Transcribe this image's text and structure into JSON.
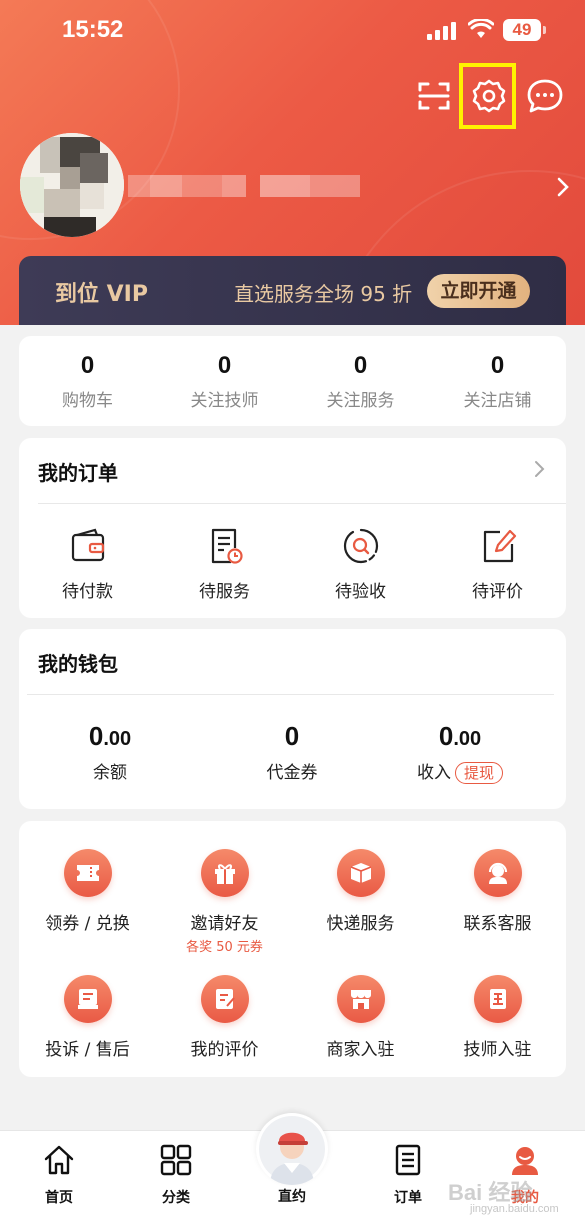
{
  "status_bar": {
    "time": "15:52",
    "battery": "49"
  },
  "header": {
    "icons": [
      "scan-icon",
      "settings-icon",
      "message-icon"
    ]
  },
  "vip": {
    "title": "到位 VIP",
    "desc": "直选服务全场 95 折",
    "button": "立即开通"
  },
  "stats": [
    {
      "value": "0",
      "label": "购物车"
    },
    {
      "value": "0",
      "label": "关注技师"
    },
    {
      "value": "0",
      "label": "关注服务"
    },
    {
      "value": "0",
      "label": "关注店铺"
    }
  ],
  "orders": {
    "title": "我的订单",
    "items": [
      {
        "label": "待付款",
        "icon": "wallet-icon"
      },
      {
        "label": "待服务",
        "icon": "service-doc-icon"
      },
      {
        "label": "待验收",
        "icon": "inspect-icon"
      },
      {
        "label": "待评价",
        "icon": "review-edit-icon"
      }
    ]
  },
  "wallet": {
    "title": "我的钱包",
    "items": [
      {
        "int": "0",
        "dec": ".00",
        "label": "余额"
      },
      {
        "int": "0",
        "dec": "",
        "label": "代金券"
      },
      {
        "int": "0",
        "dec": ".00",
        "label": "收入",
        "action": "提现"
      }
    ]
  },
  "services": [
    {
      "label": "领券 / 兑换",
      "icon": "coupon-icon"
    },
    {
      "label": "邀请好友",
      "sub": "各奖 50 元券",
      "icon": "gift-icon"
    },
    {
      "label": "快递服务",
      "icon": "package-icon"
    },
    {
      "label": "联系客服",
      "icon": "customer-service-icon"
    },
    {
      "label": "投诉 / 售后",
      "icon": "complaint-icon"
    },
    {
      "label": "我的评价",
      "icon": "my-review-icon"
    },
    {
      "label": "商家入驻",
      "icon": "store-icon"
    },
    {
      "label": "技师入驻",
      "icon": "technician-icon"
    }
  ],
  "tabbar": {
    "items": [
      {
        "label": "首页",
        "icon": "home-icon"
      },
      {
        "label": "分类",
        "icon": "category-icon"
      },
      {
        "label": "直约",
        "icon": "technician-avatar-icon"
      },
      {
        "label": "订单",
        "icon": "order-list-icon"
      },
      {
        "label": "我的",
        "icon": "profile-icon"
      }
    ],
    "active": "我的"
  },
  "watermark": {
    "text": "Bai 经验",
    "sub": "jingyan.baidu.com"
  },
  "colors": {
    "accent": "#e85a42",
    "vip_bg": "#3e3b56",
    "vip_gold": "#e9c9a2",
    "highlight": "#fff200"
  }
}
